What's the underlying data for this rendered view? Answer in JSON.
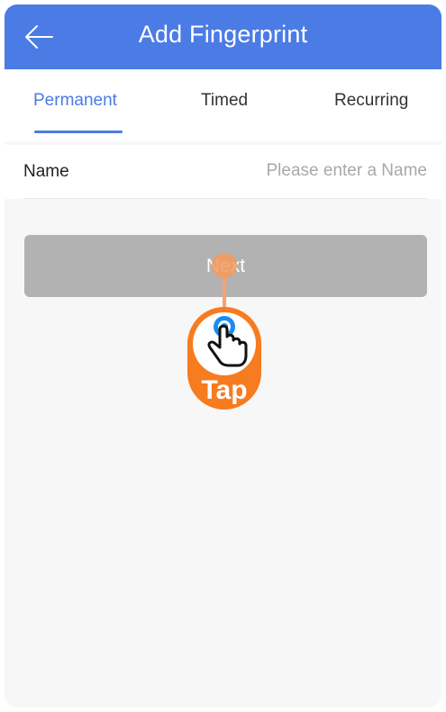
{
  "header": {
    "title": "Add Fingerprint",
    "back_icon": "arrow-left-icon"
  },
  "tabs": [
    {
      "label": "Permanent",
      "active": true
    },
    {
      "label": "Timed",
      "active": false
    },
    {
      "label": "Recurring",
      "active": false
    }
  ],
  "form": {
    "name_label": "Name",
    "name_placeholder": "Please enter a Name",
    "name_value": ""
  },
  "actions": {
    "next_label": "Next"
  },
  "overlay": {
    "tap_label": "Tap",
    "icon": "pointing-hand-icon"
  },
  "colors": {
    "accent": "#4b7be5",
    "button_disabled": "#b2b2b2",
    "tap_orange": "#f77b1f"
  }
}
